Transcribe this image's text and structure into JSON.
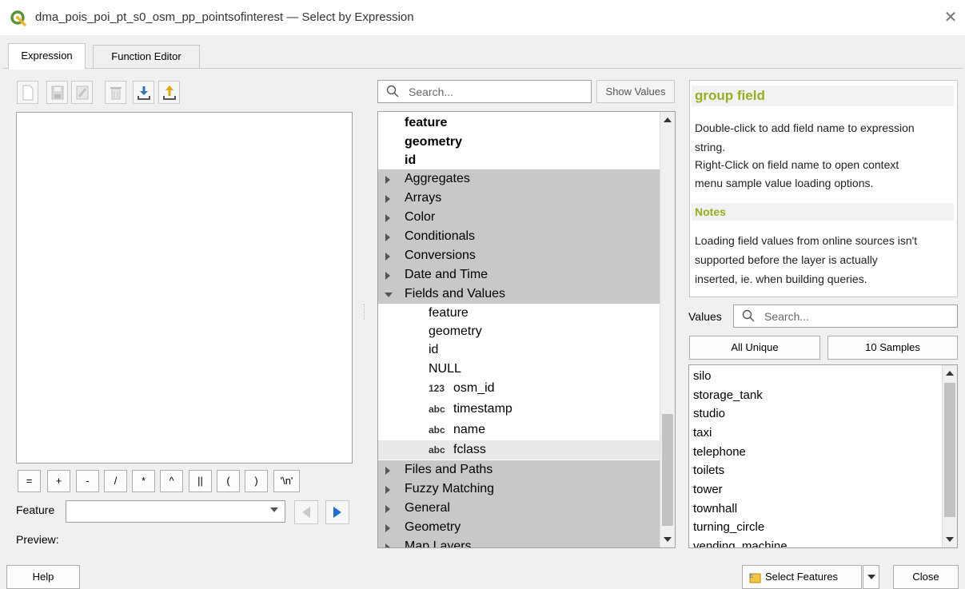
{
  "window": {
    "title": "dma_pois_poi_pt_s0_osm_pp_pointsofinterest — Select by Expression",
    "close_glyph": "✕"
  },
  "tabs": [
    {
      "label": "Expression",
      "active": true
    },
    {
      "label": "Function Editor",
      "active": false
    }
  ],
  "toolbar": {
    "icons": [
      "new-file-icon",
      "save-icon",
      "edit-icon",
      "delete-icon",
      "import-icon",
      "export-icon"
    ]
  },
  "operators": [
    "=",
    "+",
    "-",
    "/",
    "*",
    "^",
    "||",
    "(",
    ")",
    "'\\n'"
  ],
  "feature": {
    "label": "Feature",
    "value": ""
  },
  "preview": {
    "label": "Preview:"
  },
  "search": {
    "placeholder": "Search...",
    "show_values_label": "Show Values"
  },
  "tree": {
    "top_items": [
      "feature",
      "geometry",
      "id"
    ],
    "groups_before": [
      "Aggregates",
      "Arrays",
      "Color",
      "Conditionals",
      "Conversions",
      "Date and Time"
    ],
    "expanded_group": "Fields and Values",
    "fields_plain": [
      "feature",
      "geometry",
      "id",
      "NULL"
    ],
    "fields_typed": [
      {
        "type": "123",
        "name": "osm_id"
      },
      {
        "type": "abc",
        "name": "timestamp"
      },
      {
        "type": "abc",
        "name": "name"
      },
      {
        "type": "abc",
        "name": "fclass",
        "selected": true
      }
    ],
    "groups_after": [
      "Files and Paths",
      "Fuzzy Matching",
      "General",
      "Geometry",
      "Map Layers"
    ]
  },
  "help": {
    "title": "group field",
    "lines": [
      "Double-click to add field name to expression",
      "string.",
      "Right-Click on field name to open context",
      "menu sample value loading options."
    ],
    "notes_title": "Notes",
    "notes_lines": [
      "Loading field values from online sources isn't",
      "supported before the layer is actually",
      "inserted, ie. when building queries."
    ]
  },
  "values": {
    "label": "Values",
    "search_placeholder": "Search...",
    "all_unique_label": "All Unique",
    "samples_label": "10 Samples",
    "items": [
      "silo",
      "storage_tank",
      "studio",
      "taxi",
      "telephone",
      "toilets",
      "tower",
      "townhall",
      "turning_circle",
      "vending_machine"
    ]
  },
  "buttons": {
    "help": "Help",
    "select_features": "Select Features",
    "close": "Close"
  },
  "colors": {
    "accent_green": "#93b023",
    "group_bg": "#c8c8c8",
    "nav_blue": "#1f6fd1"
  }
}
